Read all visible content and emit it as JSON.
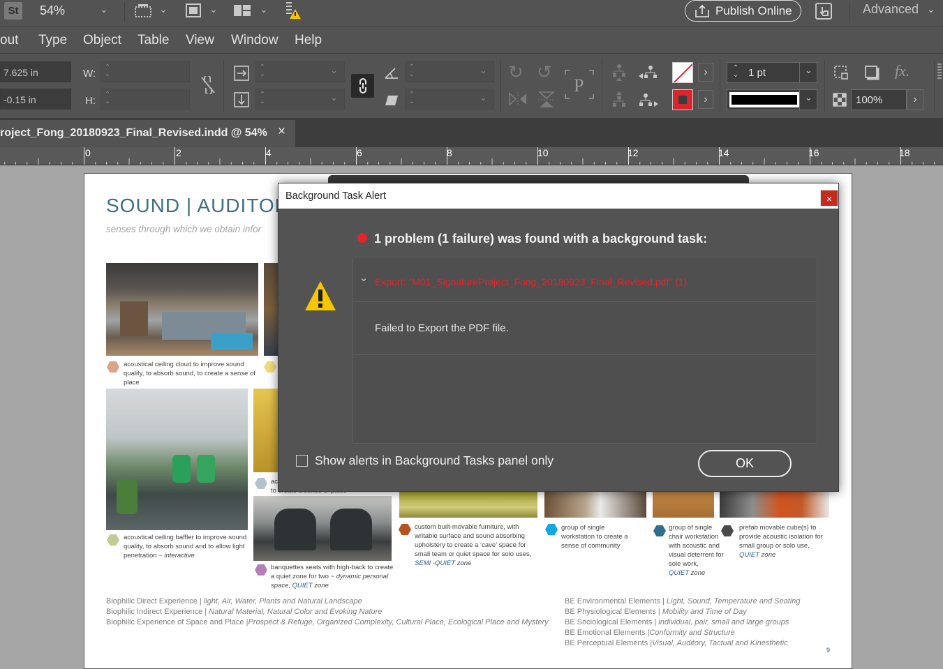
{
  "appbar": {
    "st_badge": "St",
    "zoom": "54%",
    "publish_label": "Publish Online",
    "workspace": "Advanced"
  },
  "menu": [
    "Layout",
    "Type",
    "Object",
    "Table",
    "View",
    "Window",
    "Help"
  ],
  "menu_visible": [
    "out",
    "Type",
    "Object",
    "Table",
    "View",
    "Window",
    "Help"
  ],
  "control": {
    "x_value": "7.625 in",
    "y_value": "-0.15 in",
    "w_label": "W:",
    "h_label": "H:",
    "stroke_weight": "1 pt",
    "opacity": "100%",
    "fx_label": "fx."
  },
  "document_tab": {
    "title": "roject_Fong_20180923_Final_Revised.indd @ 54%",
    "close": "×"
  },
  "ruler": {
    "ticks": [
      "0",
      "2",
      "4",
      "6",
      "8",
      "10",
      "12",
      "14",
      "16",
      "18"
    ]
  },
  "page": {
    "heading": "SOUND | AUDITOR",
    "subheading": "senses through which we obtain infor",
    "captions": {
      "c1": "acoustical ceiling cloud to improve sound quality, to absorb sound, to create a sense of place",
      "c2": "acoustical ceiling baffler to improve sound quality, to absorb sound and to allow light penetration ~ ",
      "c2_em": "interactive",
      "c3_a": "ac",
      "c3_b": "to create a sense of place",
      "c4": "banquettes seats with high-back to create a quiet zone for two ~ ",
      "c4_em": "dynamic personal space, ",
      "c4_zone": "QUIET",
      "c4_tail": " zone",
      "c5": "custom built-movable furniture, with writable surface and sound absorbing upholstery to create a ‘cave’ space for small team or quiet space for solo uses,",
      "c5_zone": "SEMI -QUIET",
      "c5_tail": " zone",
      "c6": "group of single workstation to create a sense of community",
      "c7": "group of single chair workstation with acoustic and visual deterrent for sole work,",
      "c7_zone": "QUIET",
      "c7_tail": " zone",
      "c8": "prefab movable cube(s) to provide acoustic isolation for small group or solo use,",
      "c8_zone": "QUIET",
      "c8_tail": " zone"
    },
    "footer_left": [
      {
        "a": "Biophilic Direct Experience | ",
        "b": "light, Air, Water, Plants and Natural Landscape"
      },
      {
        "a": "Biophilic Indirect Experience | ",
        "b": "Natural Material, Natural Color and Evoking Nature"
      },
      {
        "a": "Biophilic Experience of Space and Place |",
        "b": "Prospect & Refuge, Organized Complexity, Cultural Place,  Ecological Place and Mystery"
      }
    ],
    "footer_right": [
      {
        "a": "BE Environmental Elements | ",
        "b": "Light, Sound, Temperature and Seating"
      },
      {
        "a": "BE Physiological Elements | ",
        "b": "Mobility and Time of Day"
      },
      {
        "a": "BE Sociological Elements | ",
        "b": "individual, pair, small and large groups"
      },
      {
        "a": "BE Emotional Elements |",
        "b": "Conformity and Structure"
      },
      {
        "a": "BE Perceptual Elements |",
        "b": "Visual, Auditory, Tactual and Kinesthetic"
      }
    ],
    "page_number": "9"
  },
  "dialog": {
    "title": "Background Task Alert",
    "close": "×",
    "headline": "1 problem (1 failure) was found with a background task:",
    "export_line": "Export: \"M01_SignatureProject_Fong_20180923_Final_Revised.pdf\" (1)",
    "message": "Failed to Export the PDF file.",
    "checkbox_label": "Show alerts in Background Tasks panel only",
    "ok_label": "OK"
  },
  "colors": {
    "app_bg": "#535353",
    "dialog_bg": "#535353",
    "error_red": "#e0262c",
    "warning_yellow": "#f7c600",
    "heading_teal": "#3f6f82",
    "zone_blue": "#2e5d8c"
  }
}
